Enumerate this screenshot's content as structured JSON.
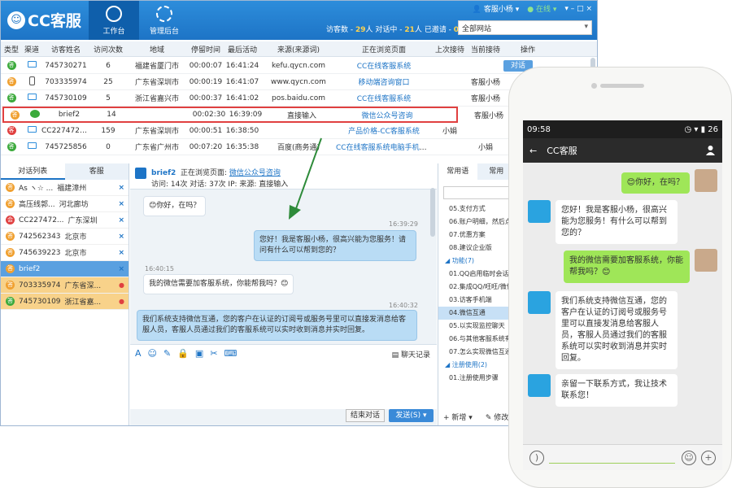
{
  "app": {
    "logo": "CC客服",
    "nav": [
      {
        "label": "工作台"
      },
      {
        "label": "管理后台"
      }
    ],
    "user": "客服小杨",
    "status": "在线",
    "stats": {
      "visitors_label": "访客数 -",
      "visitors": "29",
      "unit": "人",
      "chatting_label": "对话中 -",
      "chatting": "21",
      "ended_label": "已邀请 -",
      "ended": "0"
    },
    "site_select": "全部网站"
  },
  "table": {
    "headers": [
      "类型",
      "渠道",
      "访客姓名",
      "访问次数",
      "地域",
      "停留时间",
      "最后活动",
      "来源(来源词)",
      "正在浏览页面",
      "上次接待",
      "当前接待",
      "操作"
    ],
    "rows": [
      {
        "type": "答",
        "type_color": "g",
        "channel": "pc",
        "name": "745730271",
        "visits": "6",
        "region": "福建省厦门市",
        "stay": "00:00:07",
        "last": "16:41:24",
        "source": "kefu.qycn.com",
        "page": "CC在线客服系统",
        "prev": "",
        "cur": "",
        "ops": [
          "对话",
          "邀请"
        ]
      },
      {
        "type": "答",
        "type_color": "o",
        "channel": "mobile",
        "name": "703335974",
        "visits": "25",
        "region": "广东省深圳市",
        "stay": "00:00:19",
        "last": "16:41:07",
        "source": "www.qycn.com",
        "page": "移动端咨询窗口",
        "prev": "",
        "cur": "客服小杨",
        "ops": []
      },
      {
        "type": "答",
        "type_color": "g",
        "channel": "pc",
        "name": "745730109",
        "visits": "5",
        "region": "浙江省嘉兴市",
        "stay": "00:00:37",
        "last": "16:41:02",
        "source": "pos.baidu.com",
        "page": "CC在线客服系统",
        "prev": "",
        "cur": "客服小杨",
        "ops": []
      },
      {
        "type": "答",
        "type_color": "o",
        "channel": "wechat",
        "name": "brief2",
        "visits": "14",
        "region": "",
        "stay": "00:02:30",
        "last": "16:39:09",
        "source": "直接输入",
        "page": "微信公众号咨询",
        "prev": "",
        "cur": "客服小杨",
        "ops": []
      },
      {
        "type": "客",
        "type_color": "r",
        "channel": "pc",
        "name": "CC22747289(...",
        "visits": "159",
        "region": "广东省深圳市",
        "stay": "00:00:51",
        "last": "16:38:50",
        "source": "",
        "page": "产品价格-CC客服系统",
        "prev": "小娟",
        "cur": "",
        "ops": []
      },
      {
        "type": "答",
        "type_color": "g",
        "channel": "pc",
        "name": "745725856",
        "visits": "0",
        "region": "广东省广州市",
        "stay": "00:07:20",
        "last": "16:35:38",
        "source": "百度(商务通)",
        "page": "CC在线客服系统电脑手机客户...",
        "prev": "",
        "cur": "小娟",
        "ops": []
      }
    ]
  },
  "left": {
    "tabs": [
      "对话列表",
      "客服"
    ],
    "items": [
      {
        "badge": "答",
        "color": "o",
        "name": "As ヽ☆ ...",
        "region": "福建漳州",
        "flag": "x"
      },
      {
        "badge": "答",
        "color": "o",
        "name": "高压线郭...",
        "region": "河北廊坊",
        "flag": "x"
      },
      {
        "badge": "会",
        "color": "r",
        "name": "CC227472...",
        "region": "广东深圳",
        "flag": "x"
      },
      {
        "badge": "答",
        "color": "o",
        "name": "742562343",
        "region": "北京市",
        "flag": "x"
      },
      {
        "badge": "答",
        "color": "o",
        "name": "745639223",
        "region": "北京市",
        "flag": "x"
      },
      {
        "badge": "答",
        "color": "o",
        "name": "brief2",
        "region": "",
        "flag": "x"
      },
      {
        "badge": "答",
        "color": "o",
        "name": "703335974",
        "region": "广东省深...",
        "flag": "chat"
      },
      {
        "badge": "答",
        "color": "g",
        "name": "745730109",
        "region": "浙江省嘉...",
        "flag": "chat"
      }
    ]
  },
  "chat": {
    "visitor": "brief2",
    "browsing_label": "正在浏览页面",
    "browsing_page": "微信公众号咨询",
    "line2": "访问: 14次 对话: 37次 IP: 来源: 直接输入",
    "messages": [
      {
        "side": "l",
        "text": "你好，在吗？",
        "time": ""
      },
      {
        "side": "r",
        "text": "您好！我是客服小杨，很高兴能为您服务！请问有什么可以帮到您的？",
        "time": "16:39:29"
      },
      {
        "side": "l",
        "text": "我的微信需要加客服系统，你能帮我吗？",
        "time": "16:40:15"
      },
      {
        "side": "r",
        "text": "我们系统支持微信互通，您的客户在认证的订阅号或服务号里可以直接发消息给客服人员，客服人员通过我们的客服系统可以实时收到消息并实时回复。",
        "time": "16:40:32"
      }
    ],
    "record": "聊天记录",
    "end_btn": "结束对话",
    "send_btn": "发送(S)"
  },
  "right": {
    "tabs": [
      "常用语",
      "常用"
    ],
    "items": [
      {
        "text": "05.支付方式",
        "grp": false
      },
      {
        "text": "06.账户明细，然后点",
        "grp": false
      },
      {
        "text": "07.优惠方案",
        "grp": false
      },
      {
        "text": "08.建议企业版",
        "grp": false
      },
      {
        "text": "◢ 功能(7)",
        "grp": true
      },
      {
        "text": "01.QQ启用临时会话",
        "grp": false
      },
      {
        "text": "02.集成QQ/旺旺/微信",
        "grp": false
      },
      {
        "text": "03.访客手机端",
        "grp": false
      },
      {
        "text": "04.微信互通",
        "grp": false,
        "cur": true
      },
      {
        "text": "05.以实现监控聊天",
        "grp": false
      },
      {
        "text": "06.与其他客服系统有",
        "grp": false
      },
      {
        "text": "07.怎么实现微信互通",
        "grp": false
      },
      {
        "text": "◢ 注册使用(2)",
        "grp": true
      },
      {
        "text": "01.注册使用步骤",
        "grp": false
      }
    ],
    "new_btn": "新增",
    "edit_btn": "修改"
  },
  "phone": {
    "time": "09:58",
    "battery": "26",
    "title": "CC客服",
    "messages": [
      {
        "side": "r",
        "text": "你好，在吗？"
      },
      {
        "side": "l",
        "text": "您好！我是客服小杨，很高兴能为您服务！有什么可以帮到您的？"
      },
      {
        "side": "r",
        "text": "我的微信需要加客服系统，你能帮我吗？"
      },
      {
        "side": "l",
        "text": "我们系统支持微信互通，您的客户在认证的订阅号或服务号里可以直接发消息给客服人员，客服人员通过我们的客服系统可以实时收到消息并实时回复。"
      },
      {
        "side": "l",
        "text": "亲留一下联系方式，我让技术联系您！"
      }
    ]
  }
}
